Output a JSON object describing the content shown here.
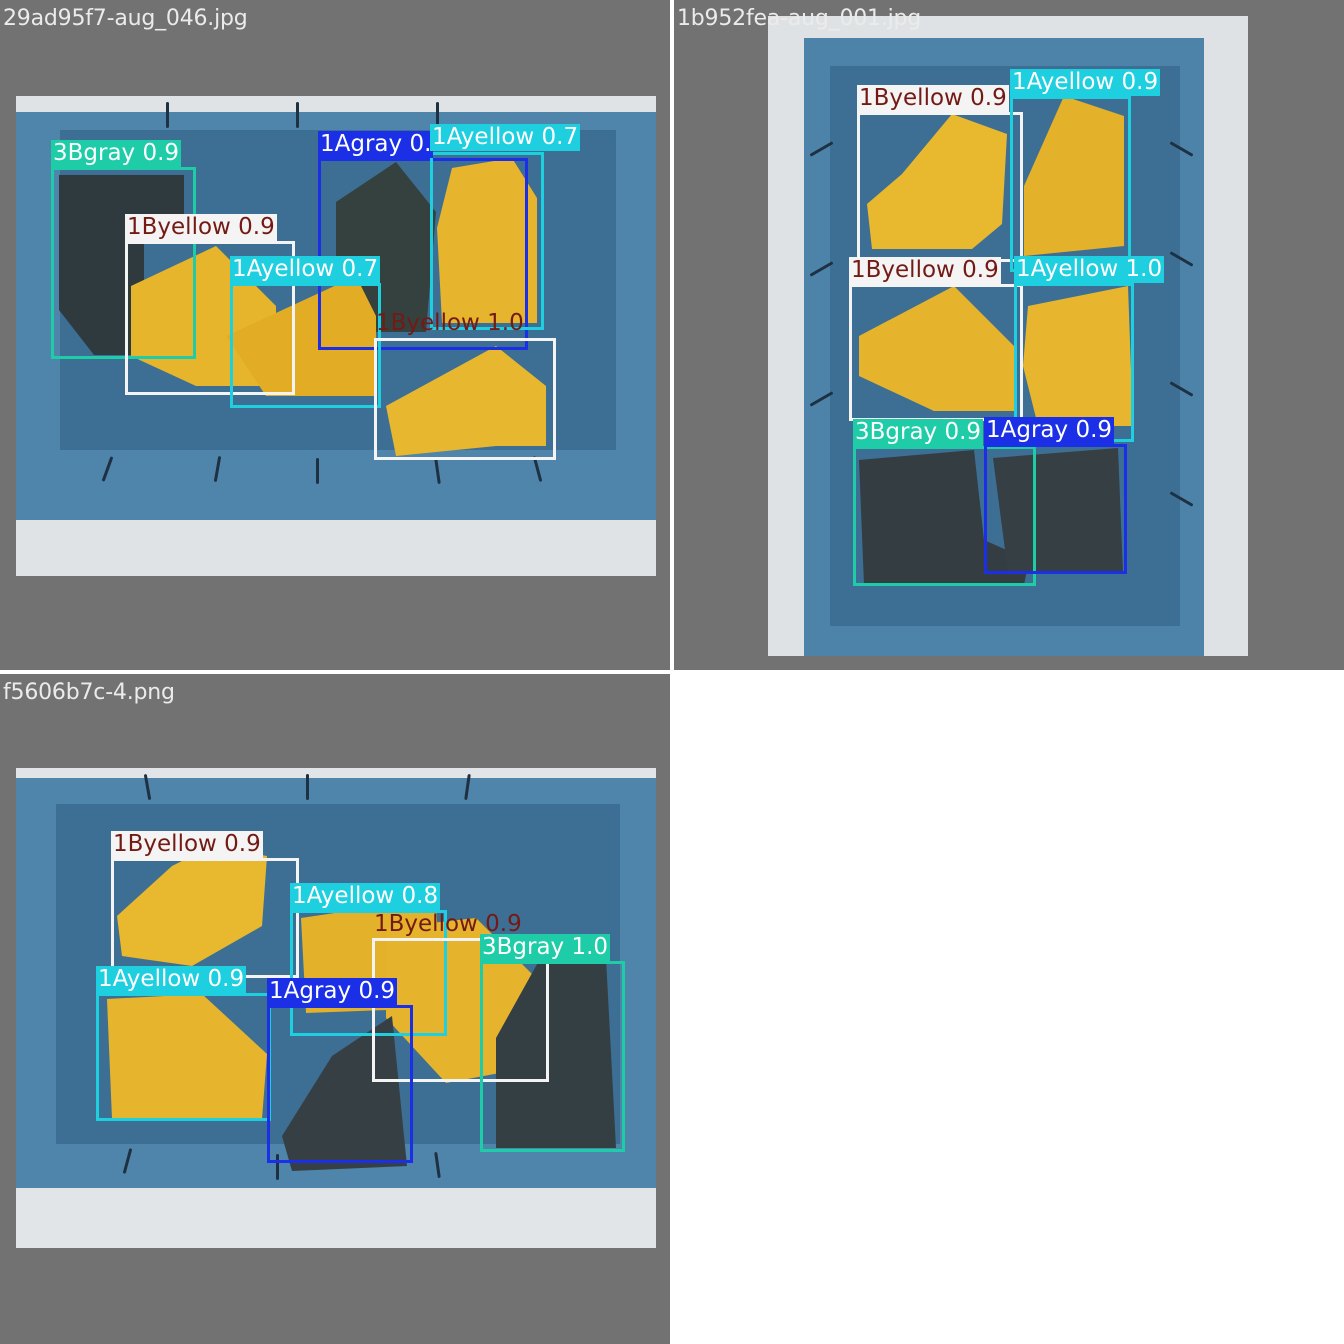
{
  "panels": [
    {
      "filename": "29ad95f7-aug_046.jpg",
      "detections": [
        {
          "label": "3Bgray 0.9"
        },
        {
          "label": "1Agray 0."
        },
        {
          "label": "1Ayellow 0.7"
        },
        {
          "label": "1Byellow 0.9"
        },
        {
          "label": "1Ayellow 0.7"
        },
        {
          "label": "1Byellow 1.0"
        }
      ]
    },
    {
      "filename": "1b952fea-aug_001.jpg",
      "detections": [
        {
          "label": "1Byellow 0.9"
        },
        {
          "label": "1Ayellow 0.9"
        },
        {
          "label": "1Byellow 0.9"
        },
        {
          "label": "1Ayellow 1.0"
        },
        {
          "label": "3Bgray 0.9"
        },
        {
          "label": "1Agray 0.9"
        }
      ]
    },
    {
      "filename": "f5606b7c-4.png",
      "detections": [
        {
          "label": "1Byellow 0.9"
        },
        {
          "label": "1Ayellow 0.8"
        },
        {
          "label": "1Byellow 0.9"
        },
        {
          "label": "3Bgray 1.0"
        },
        {
          "label": "1Ayellow 0.9"
        },
        {
          "label": "1Agray 0.9"
        }
      ]
    }
  ],
  "colors": {
    "Byellow": "#f4f4f4",
    "Ayellow": "#1ecfe0",
    "Agray": "#1a2fe6",
    "Bgray": "#1ecda7",
    "Byellow_text": "#741a14",
    "panel_bg": "#727272"
  }
}
